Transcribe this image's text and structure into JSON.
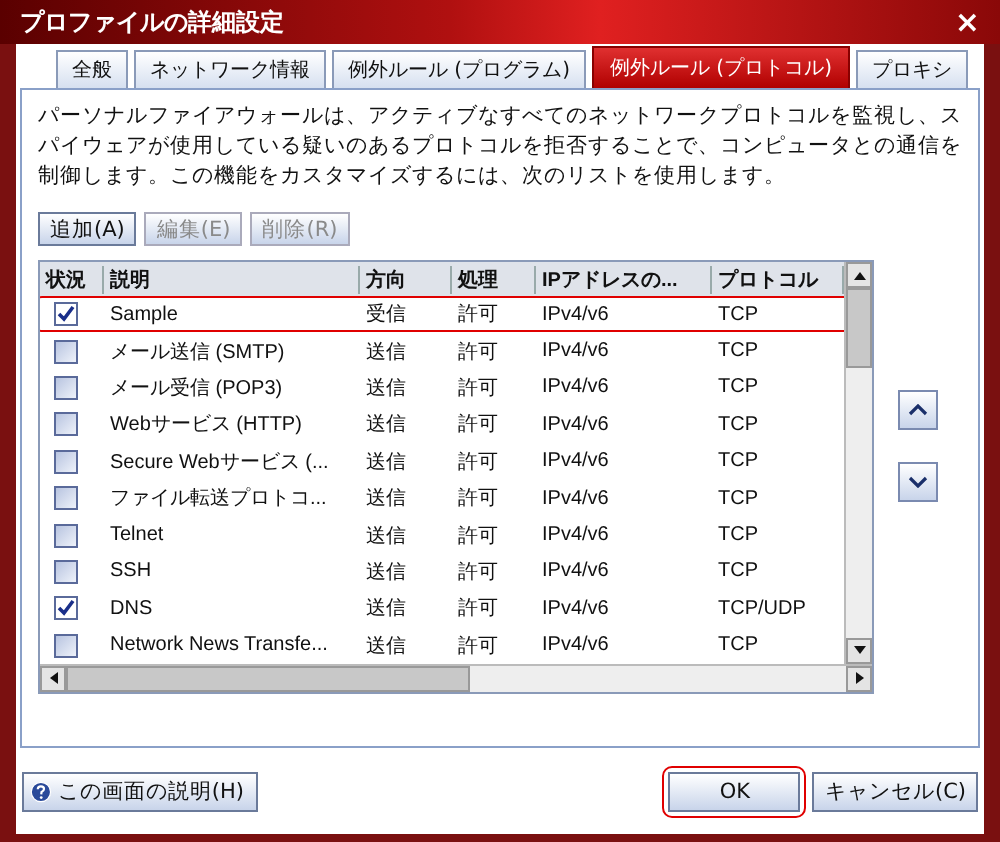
{
  "window": {
    "title": "プロファイルの詳細設定",
    "close": "×"
  },
  "tabs": [
    {
      "label": "全般",
      "selected": false
    },
    {
      "label": "ネットワーク情報",
      "selected": false
    },
    {
      "label": "例外ルール (プログラム)",
      "selected": false
    },
    {
      "label": "例外ルール (プロトコル)",
      "selected": true
    },
    {
      "label": "プロキシ",
      "selected": false
    }
  ],
  "description": "パーソナルファイアウォールは、アクティブなすべてのネットワークプロトコルを監視し、スパイウェアが使用している疑いのあるプロトコルを拒否することで、コンピュータとの通信を制御します。この機能をカスタマイズするには、次のリストを使用します。",
  "actions": [
    {
      "label": "追加(A)",
      "disabled": false
    },
    {
      "label": "編集(E)",
      "disabled": true
    },
    {
      "label": "削除(R)",
      "disabled": true
    }
  ],
  "table": {
    "columns": [
      "状況",
      "説明",
      "方向",
      "処理",
      "IPアドレスの...",
      "プロトコル"
    ],
    "rows": [
      {
        "checked": true,
        "highlighted": true,
        "description": "Sample",
        "direction": "受信",
        "action": "許可",
        "ip": "IPv4/v6",
        "protocol": "TCP"
      },
      {
        "checked": false,
        "highlighted": false,
        "description": "メール送信 (SMTP)",
        "direction": "送信",
        "action": "許可",
        "ip": "IPv4/v6",
        "protocol": "TCP"
      },
      {
        "checked": false,
        "highlighted": false,
        "description": "メール受信 (POP3)",
        "direction": "送信",
        "action": "許可",
        "ip": "IPv4/v6",
        "protocol": "TCP"
      },
      {
        "checked": false,
        "highlighted": false,
        "description": "Webサービス (HTTP)",
        "direction": "送信",
        "action": "許可",
        "ip": "IPv4/v6",
        "protocol": "TCP"
      },
      {
        "checked": false,
        "highlighted": false,
        "description": "Secure Webサービス (...",
        "direction": "送信",
        "action": "許可",
        "ip": "IPv4/v6",
        "protocol": "TCP"
      },
      {
        "checked": false,
        "highlighted": false,
        "description": "ファイル転送プロトコ...",
        "direction": "送信",
        "action": "許可",
        "ip": "IPv4/v6",
        "protocol": "TCP"
      },
      {
        "checked": false,
        "highlighted": false,
        "description": "Telnet",
        "direction": "送信",
        "action": "許可",
        "ip": "IPv4/v6",
        "protocol": "TCP"
      },
      {
        "checked": false,
        "highlighted": false,
        "description": "SSH",
        "direction": "送信",
        "action": "許可",
        "ip": "IPv4/v6",
        "protocol": "TCP"
      },
      {
        "checked": true,
        "highlighted": false,
        "description": "DNS",
        "direction": "送信",
        "action": "許可",
        "ip": "IPv4/v6",
        "protocol": "TCP/UDP"
      },
      {
        "checked": false,
        "highlighted": false,
        "description": "Network News Transfe...",
        "direction": "送信",
        "action": "許可",
        "ip": "IPv4/v6",
        "protocol": "TCP"
      }
    ]
  },
  "footer": {
    "help": "この画面の説明(H)",
    "ok": {
      "label": "OK",
      "highlighted": true
    },
    "cancel": "キャンセル(C)"
  }
}
